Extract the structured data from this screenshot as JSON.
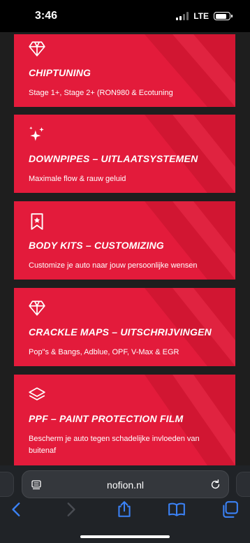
{
  "status_bar": {
    "time": "3:46",
    "network": "LTE",
    "signal_bars_active": 2,
    "signal_bars_total": 4,
    "battery_level": 0.8
  },
  "colors": {
    "card_red": "#e31b3b",
    "page_background": "#1e1e1e",
    "browser_bar": "#202327",
    "link_blue": "#3b82f6"
  },
  "services": [
    {
      "icon": "diamond-icon",
      "title": "CHIPTUNING",
      "description": "Stage 1+, Stage 2+ (RON980 & Ecotuning"
    },
    {
      "icon": "sparkles-icon",
      "title": "DOWNPIPES – UITLAATSYSTEMEN",
      "description": "Maximale flow & rauw geluid"
    },
    {
      "icon": "bookmark-star-icon",
      "title": "BODY KITS – CUSTOMIZING",
      "description": "Customize je auto naar jouw persoonlijke wensen"
    },
    {
      "icon": "diamond-icon",
      "title": "CRACKLE MAPS – UITSCHRIJVINGEN",
      "description": "Pop\"s & Bangs, Adblue, OPF, V-Max & EGR"
    },
    {
      "icon": "layers-icon",
      "title": "PPF – PAINT PROTECTION FILM",
      "description": "Bescherm je auto tegen schadelijke invloeden van buitenaf"
    }
  ],
  "browser": {
    "url": "nofion.nl",
    "toolbar": [
      "back-icon",
      "forward-icon",
      "share-icon",
      "bookmarks-icon",
      "tabs-icon"
    ]
  }
}
